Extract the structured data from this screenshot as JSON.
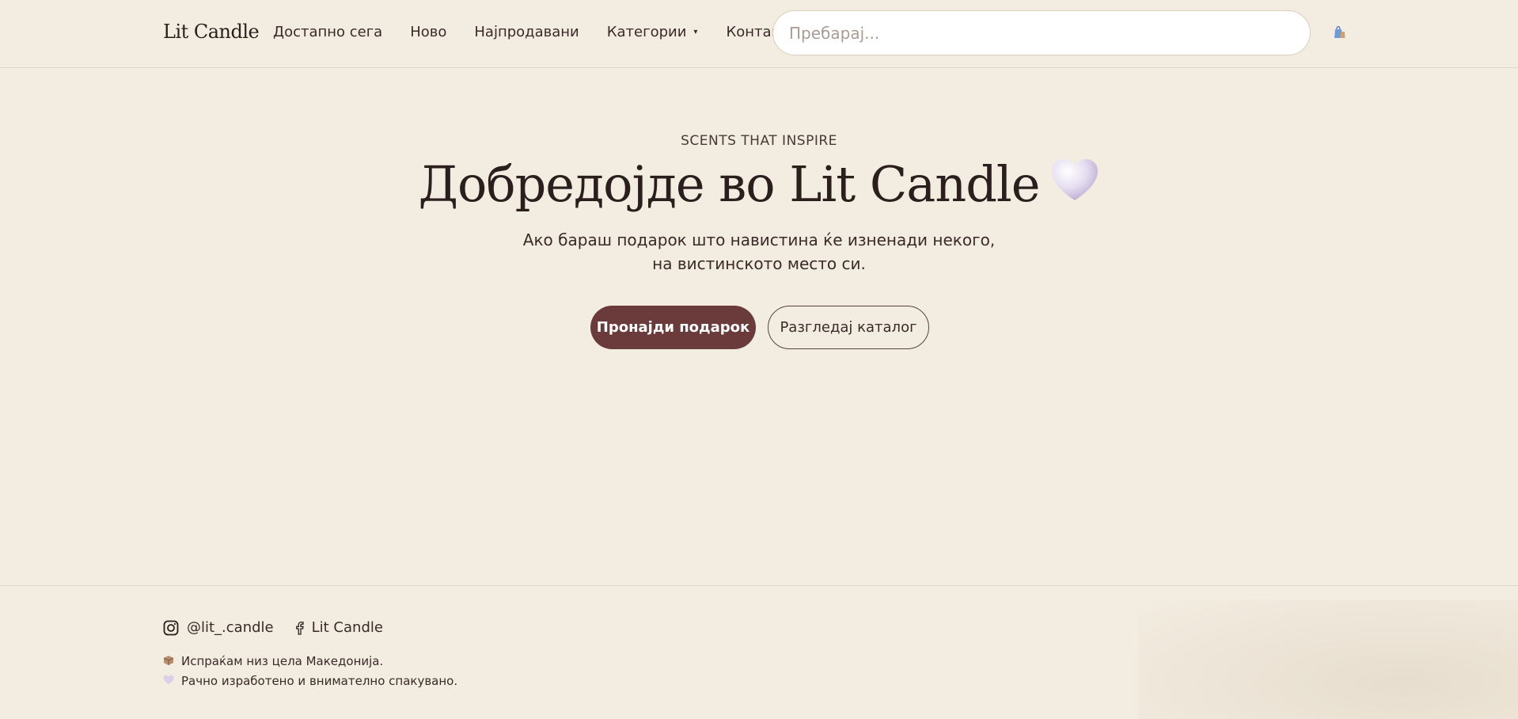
{
  "header": {
    "logo": "Lit Candle",
    "nav": [
      {
        "label": "Достапно сега"
      },
      {
        "label": "Ново"
      },
      {
        "label": "Најпродавани"
      },
      {
        "label": "Категории",
        "caret": "▾"
      },
      {
        "label": "Контакт"
      }
    ],
    "search": {
      "placeholder": "Пребарај...",
      "value": ""
    },
    "cart_icon": "shopping-bag-icon"
  },
  "hero": {
    "eyebrow": "SCENTS THAT INSPIRE",
    "title": "Добредојде во Lit Candle",
    "title_icon": "heart-icon",
    "subtitle_line1": "Ако бараш подарок што навистина ќе изненади некого,",
    "subtitle_line2": "на вистинското место си.",
    "primary_button": "Пронајди подарок",
    "secondary_button": "Разгледај каталог"
  },
  "footer": {
    "instagram": "@lit_.candle",
    "facebook": "Lit Candle",
    "shipping_note": "Испраќам низ цела Македонија.",
    "handmade_note": "Рачно изработено и внимателно спакувано."
  },
  "colors": {
    "background": "#f3ece0",
    "primary": "#6b3a3a",
    "text": "#3a2a28",
    "heart": "#d9cfea"
  }
}
